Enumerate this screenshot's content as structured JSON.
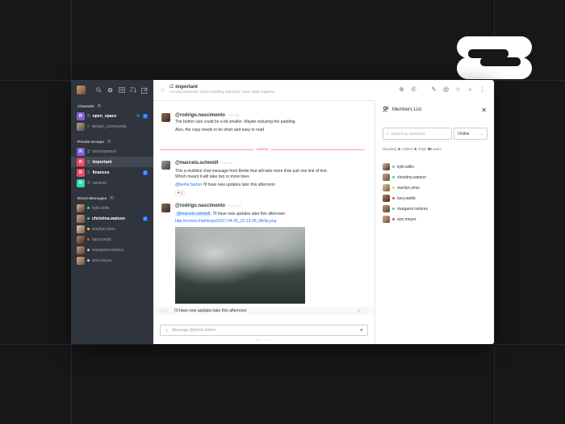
{
  "colors": {
    "accent": "#1d74f5",
    "online": "#2de0a5",
    "away": "#ffd21f",
    "busy": "#f5455c",
    "offline": "#cbced1",
    "unread": "#f5455c"
  },
  "sidebar": {
    "channels_label": "Channels",
    "channels_count": "6",
    "channels": [
      {
        "letter": "R",
        "color": "#7e61d4",
        "label": "open_space",
        "badge": "4",
        "bold": true,
        "icon": "thread-icon"
      },
      {
        "letter": "",
        "color": "#8a8f96",
        "label": "design_community",
        "badge": "",
        "bold": false,
        "icon": "hashtag-icon"
      }
    ],
    "private_label": "Private Groups",
    "private_count": "4",
    "private": [
      {
        "letter": "R",
        "color": "#7e61d4",
        "label": "development",
        "badge": "",
        "bold": false
      },
      {
        "letter": "R",
        "color": "#f5455c",
        "label": "important",
        "badge": "",
        "bold": true,
        "selected": true
      },
      {
        "letter": "R",
        "color": "#f5455c",
        "label": "finances",
        "badge": "3",
        "bold": true
      },
      {
        "letter": "R",
        "color": "#2de0a5",
        "label": "random",
        "badge": "",
        "bold": false
      }
    ],
    "dm_label": "Direct Messages",
    "dm_count": "4",
    "dms": [
      {
        "label": "kyle.willis",
        "status": "online",
        "badge": "",
        "bold": false
      },
      {
        "label": "christina.watson",
        "status": "online",
        "badge": "4",
        "bold": true
      },
      {
        "label": "marilyn.sims",
        "status": "away",
        "badge": "",
        "bold": false
      },
      {
        "label": "larry.webb",
        "status": "busy",
        "badge": "",
        "bold": false
      },
      {
        "label": "margaret.ramirez",
        "status": "offline",
        "badge": "",
        "bold": false
      },
      {
        "label": "ann.meyer",
        "status": "offline",
        "badge": "",
        "bold": false
      }
    ]
  },
  "room": {
    "title": "important",
    "topic": "Announcements, items needing attention, team wide inquires..."
  },
  "messages": [
    {
      "author": "@rodrigo.nascimento",
      "time": "9:00 AM",
      "lines": [
        "The button size could be a bit smaller. Maybe reducing the padding.",
        "Also, the copy needs to be short and easy to read"
      ]
    },
    {
      "author": "@marcelo.schmidt",
      "time": "9:01 AM",
      "lines": [
        "This a multiline chat message from Bertie that will take more than just one line of text.",
        "Which meant it will take two or more lines"
      ],
      "mention": "@bertie.barton",
      "mention_text": " I'll have new updates later this afternoon",
      "reaction": "1"
    },
    {
      "author": "@rodrigo.nascimento",
      "time": "10:17 AM",
      "mention": "@marcelo.schmidt",
      "mention_text": " I'll have new updates later this afternoon",
      "link": "http://rocket.chat/drops/2017-04-26_22-13-28_l0b9p.png"
    }
  ],
  "unread_label": "UNREAD",
  "sequential": {
    "time": "10:17",
    "text": "I'll have new updates later this afternoon"
  },
  "composer": {
    "placeholder": "Message @bertie.barton",
    "hint": "B  I  S  ~  <>  —"
  },
  "members": {
    "title": "Members List",
    "search_placeholder": "Search by username",
    "filter": "Online",
    "stats": {
      "showing": "6",
      "online": "6",
      "total": "50"
    },
    "list": [
      {
        "name": "kyle.willis",
        "status": "online"
      },
      {
        "name": "christina.watson",
        "status": "online"
      },
      {
        "name": "marilyn.sims",
        "status": "away"
      },
      {
        "name": "larry.webb",
        "status": "busy"
      },
      {
        "name": "margaret.ramirez",
        "status": "online"
      },
      {
        "name": "ann.meyer",
        "status": "busy"
      }
    ]
  }
}
